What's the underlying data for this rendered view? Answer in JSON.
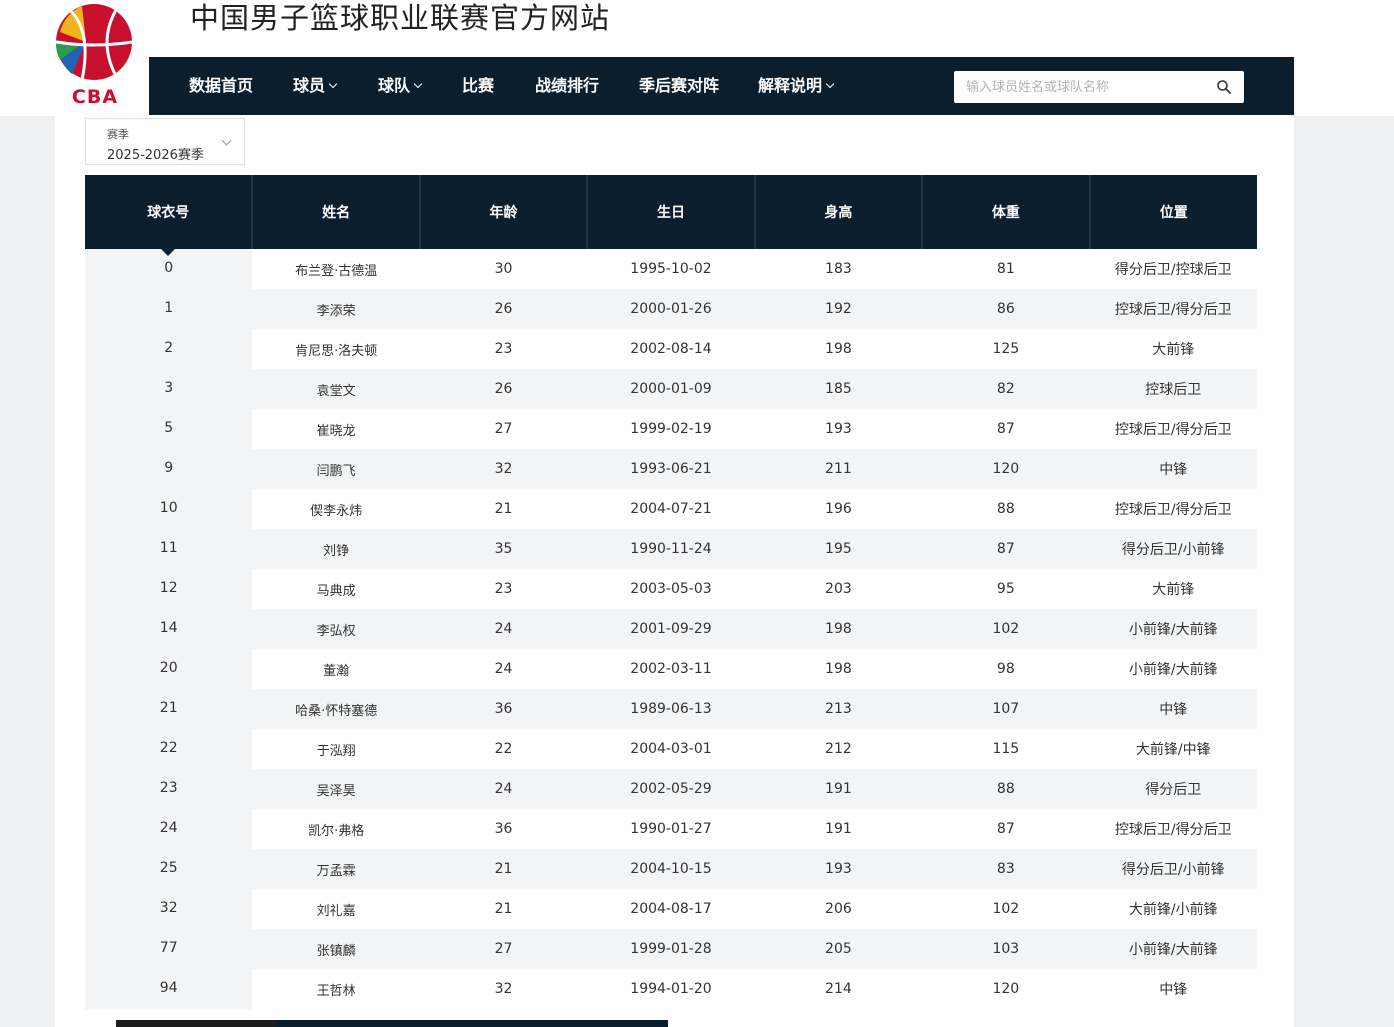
{
  "header": {
    "site_title": "中国男子篮球职业联赛官方网站",
    "logo_text": "CBA"
  },
  "nav": {
    "items": [
      {
        "label": "数据首页",
        "dropdown": false
      },
      {
        "label": "球员",
        "dropdown": true
      },
      {
        "label": "球队",
        "dropdown": true
      },
      {
        "label": "比赛",
        "dropdown": false
      },
      {
        "label": "战绩排行",
        "dropdown": false
      },
      {
        "label": "季后赛对阵",
        "dropdown": false
      },
      {
        "label": "解释说明",
        "dropdown": true
      }
    ],
    "search_placeholder": "输入球员姓名或球队名称",
    "search_icon": "search-icon"
  },
  "season_select": {
    "label": "赛季",
    "value": "2025-2026赛季"
  },
  "roster": {
    "columns": [
      "球衣号",
      "姓名",
      "年龄",
      "生日",
      "身高",
      "体重",
      "位置"
    ],
    "rows": [
      [
        "0",
        "布兰登·古德温",
        "30",
        "1995-10-02",
        "183",
        "81",
        "得分后卫/控球后卫"
      ],
      [
        "1",
        "李添荣",
        "26",
        "2000-01-26",
        "192",
        "86",
        "控球后卫/得分后卫"
      ],
      [
        "2",
        "肯尼思·洛夫顿",
        "23",
        "2002-08-14",
        "198",
        "125",
        "大前锋"
      ],
      [
        "3",
        "袁堂文",
        "26",
        "2000-01-09",
        "185",
        "82",
        "控球后卫"
      ],
      [
        "5",
        "崔晓龙",
        "27",
        "1999-02-19",
        "193",
        "87",
        "控球后卫/得分后卫"
      ],
      [
        "9",
        "闫鹏飞",
        "32",
        "1993-06-21",
        "211",
        "120",
        "中锋"
      ],
      [
        "10",
        "偰李永炜",
        "21",
        "2004-07-21",
        "196",
        "88",
        "控球后卫/得分后卫"
      ],
      [
        "11",
        "刘铮",
        "35",
        "1990-11-24",
        "195",
        "87",
        "得分后卫/小前锋"
      ],
      [
        "12",
        "马典成",
        "23",
        "2003-05-03",
        "203",
        "95",
        "大前锋"
      ],
      [
        "14",
        "李弘权",
        "24",
        "2001-09-29",
        "198",
        "102",
        "小前锋/大前锋"
      ],
      [
        "20",
        "董瀚",
        "24",
        "2002-03-11",
        "198",
        "98",
        "小前锋/大前锋"
      ],
      [
        "21",
        "哈桑·怀特塞德",
        "36",
        "1989-06-13",
        "213",
        "107",
        "中锋"
      ],
      [
        "22",
        "于泓翔",
        "22",
        "2004-03-01",
        "212",
        "115",
        "大前锋/中锋"
      ],
      [
        "23",
        "吴泽昊",
        "24",
        "2002-05-29",
        "191",
        "88",
        "得分后卫"
      ],
      [
        "24",
        "凯尔·弗格",
        "36",
        "1990-01-27",
        "191",
        "87",
        "控球后卫/得分后卫"
      ],
      [
        "25",
        "万孟霖",
        "21",
        "2004-10-15",
        "193",
        "83",
        "得分后卫/小前锋"
      ],
      [
        "32",
        "刘礼嘉",
        "21",
        "2004-08-17",
        "206",
        "102",
        "大前锋/小前锋"
      ],
      [
        "77",
        "张镇麟",
        "27",
        "1999-01-28",
        "205",
        "103",
        "小前锋/大前锋"
      ],
      [
        "94",
        "王哲林",
        "32",
        "1994-01-20",
        "214",
        "120",
        "中锋"
      ]
    ]
  },
  "colors": {
    "nav_bg": "#0b1e2e",
    "row_stripe": "#f3f4f6",
    "logo_red": "#c8102e"
  }
}
